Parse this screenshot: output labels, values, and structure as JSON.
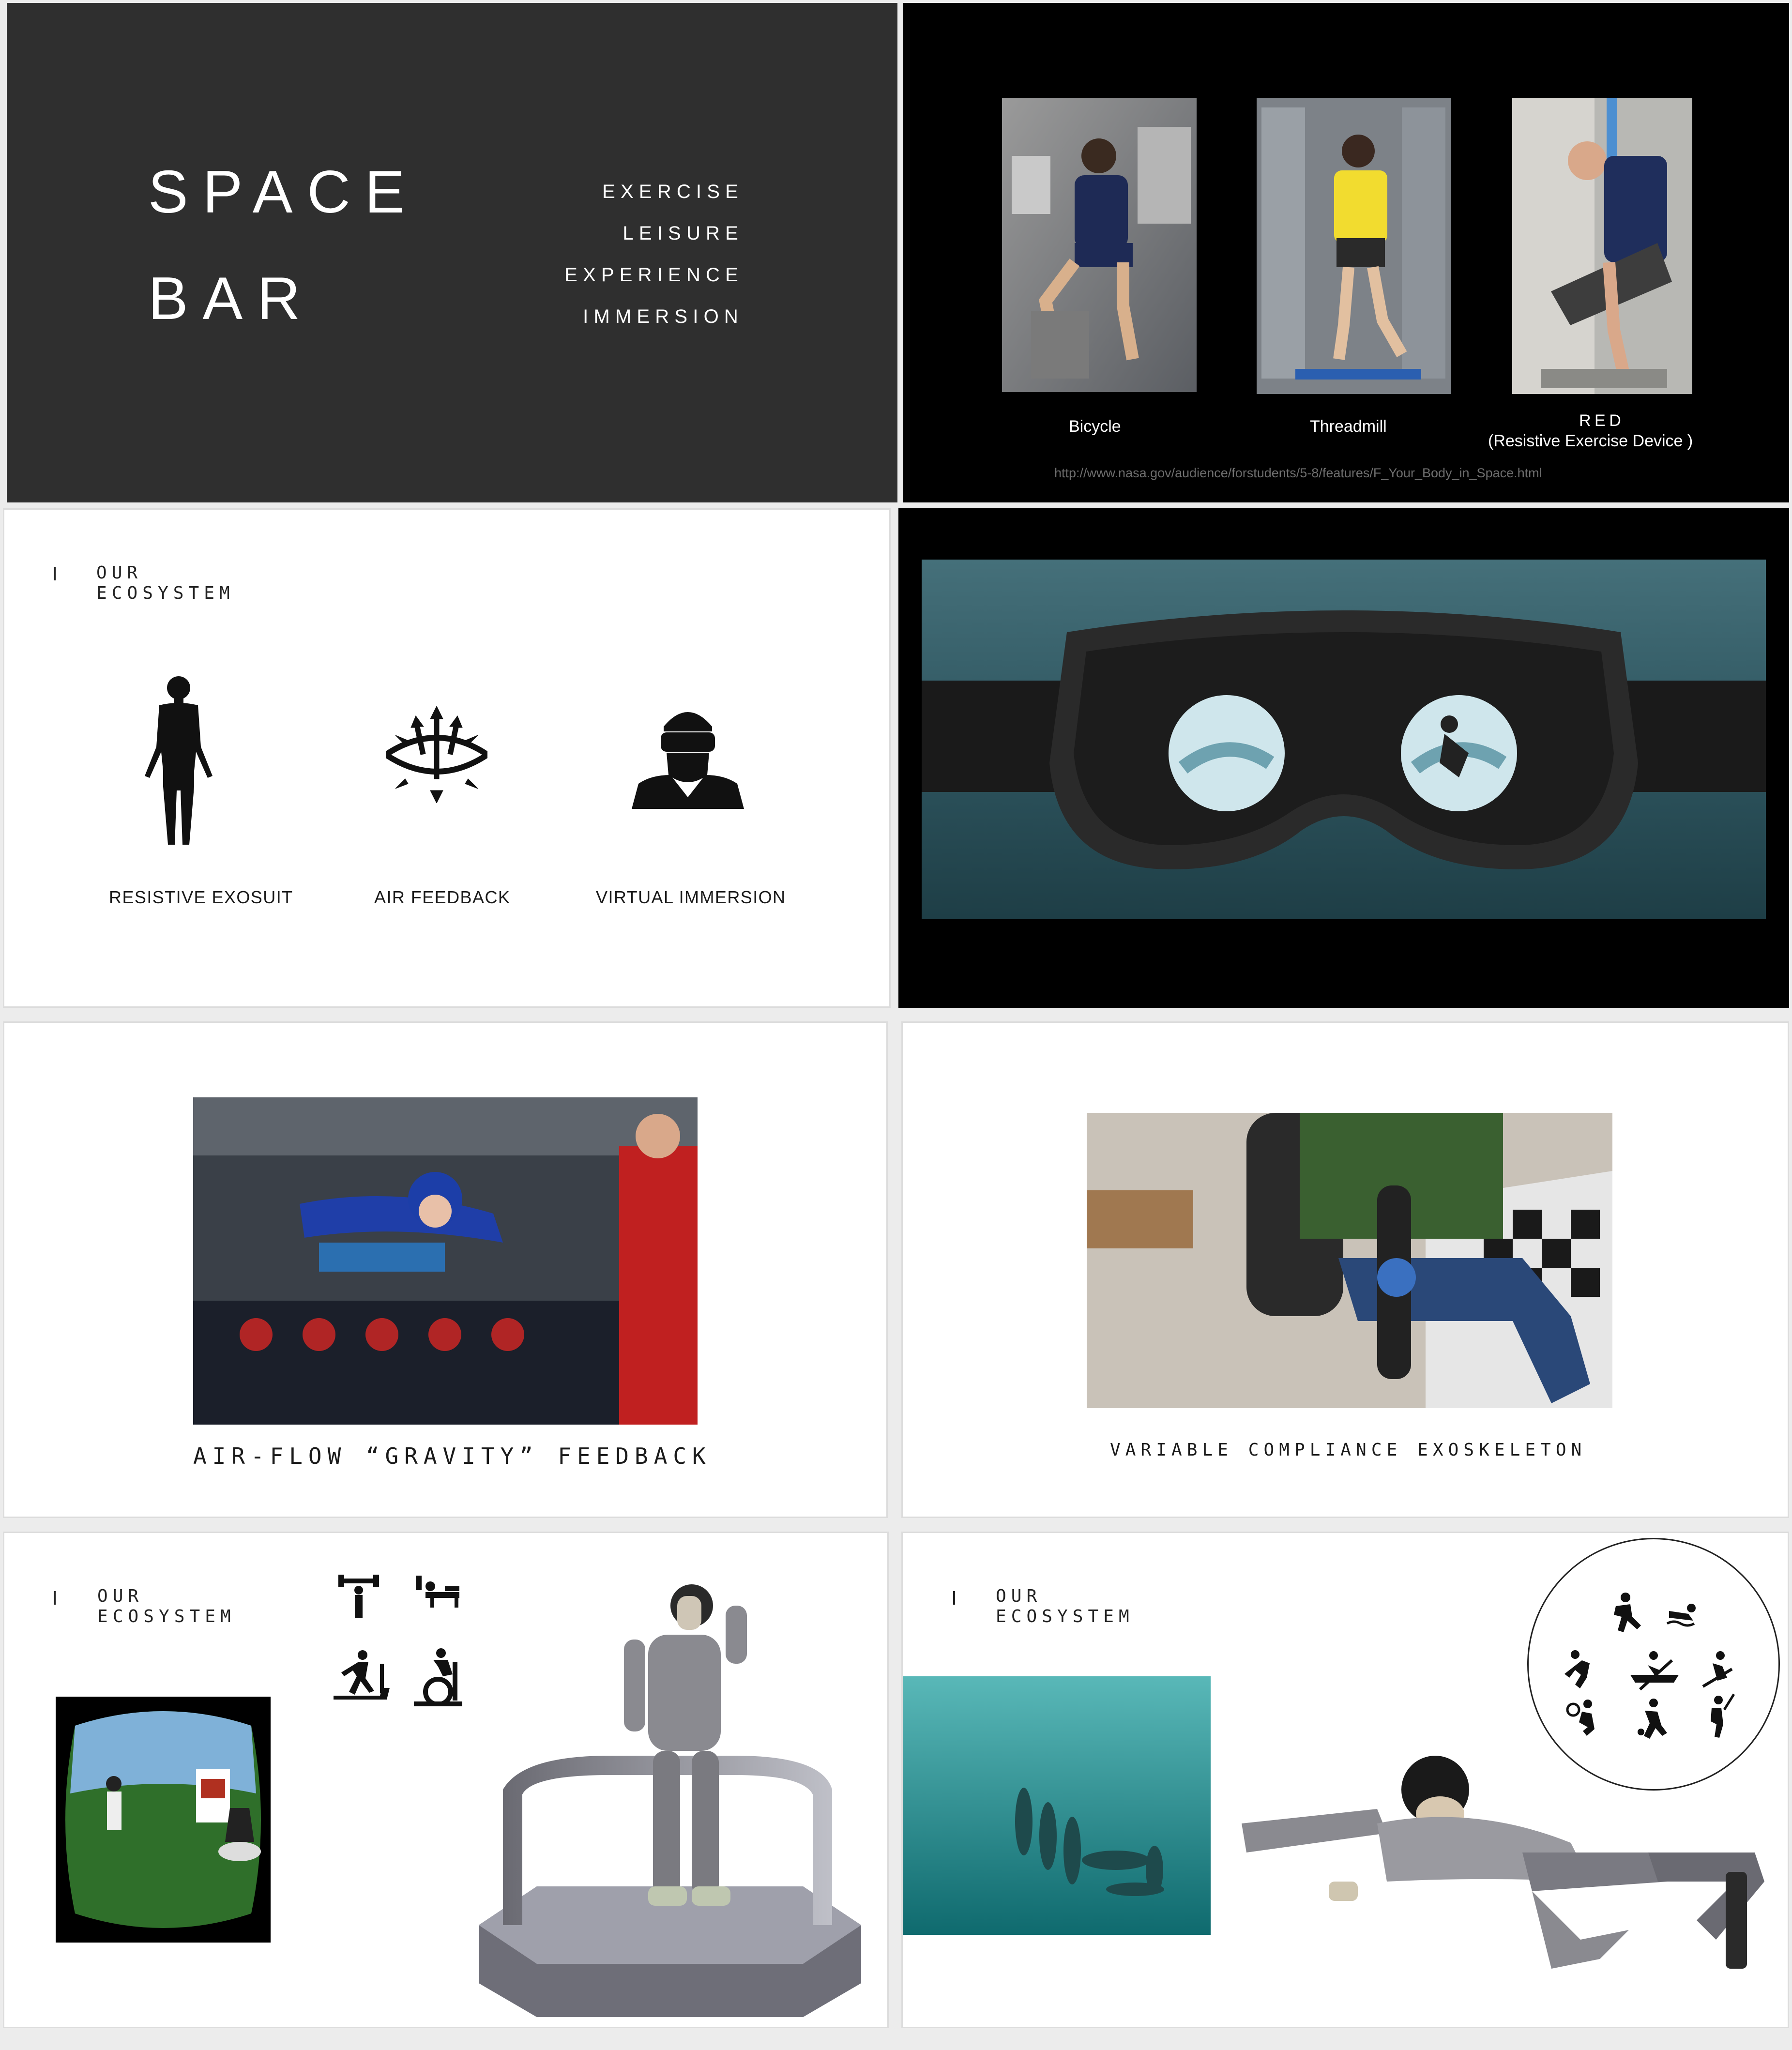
{
  "slide1": {
    "title_line1": "SPACE",
    "title_line2": "BAR",
    "menu": [
      "EXERCISE",
      "LEISURE",
      "EXPERIENCE",
      "IMMERSION"
    ]
  },
  "slide2": {
    "photos": [
      {
        "caption": "Bicycle"
      },
      {
        "caption": "Threadmill"
      },
      {
        "caption_line1": "RED",
        "caption_line2": "(Resistive Exercise Device )"
      }
    ],
    "url": "http://www.nasa.gov/audience/forstudents/5-8/features/F_Your_Body_in_Space.html"
  },
  "slide3": {
    "heading_line1": "OUR",
    "heading_line2": "ECOSYSTEM",
    "items": [
      {
        "label": "RESISTIVE EXOSUIT",
        "icon": "human-body-icon"
      },
      {
        "label": "AIR FEEDBACK",
        "icon": "air-arrows-icon"
      },
      {
        "label": "VIRTUAL IMMERSION",
        "icon": "vr-headset-person-icon"
      }
    ]
  },
  "slide5": {
    "caption": "AIR-FLOW “GRAVITY” FEEDBACK"
  },
  "slide6": {
    "caption": "VARIABLE COMPLIANCE EXOSKELETON"
  },
  "slide7": {
    "heading_line1": "OUR",
    "heading_line2": "ECOSYSTEM",
    "icons": [
      "weightlifting-icon",
      "bench-press-icon",
      "treadmill-icon",
      "exercise-bike-icon"
    ]
  },
  "slide8": {
    "heading_line1": "OUR",
    "heading_line2": "ECOSYSTEM",
    "sport_icons": [
      "sprinting-icon",
      "swimming-icon",
      "volleyball-icon",
      "rowing-icon",
      "skiing-icon",
      "tennis-icon",
      "soccer-icon",
      "golf-icon"
    ]
  },
  "colors": {
    "dark_slide": "#2f2f2f",
    "black_slide": "#000000",
    "white_slide": "#ffffff",
    "url_text": "#6e6e6e"
  }
}
